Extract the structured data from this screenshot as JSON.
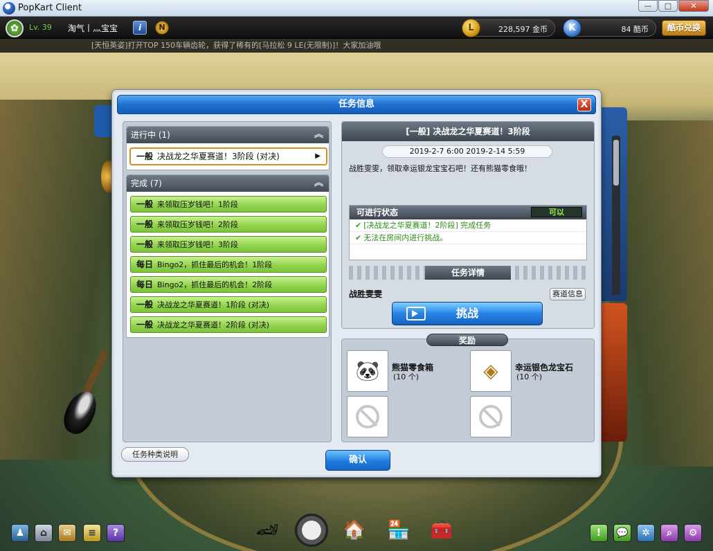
{
  "window": {
    "title": "PopKart Client",
    "min": "—",
    "max": "□",
    "close": "✕"
  },
  "player": {
    "level": "Lv. 39",
    "name": "淘气丨灬宝宝",
    "info_icon": "i",
    "badge": "N"
  },
  "currency": {
    "coin_icon": "L",
    "coins": "228,597 金币",
    "k_icon": "K",
    "kcoins": "84 酷币",
    "exchange": "酷币兑换"
  },
  "ticker": "[天恒英姿]打开TOP 150车辆齿轮，获得了稀有的[马拉松 9 LE(无限制)]！大家加油哦",
  "dialog": {
    "title": "任务信息",
    "close": "X",
    "in_progress": {
      "header": "进行中 (1)",
      "chevron": "︽",
      "items": [
        {
          "tag": "一般",
          "label": "决战龙之华夏赛道！3阶段 (对决)",
          "arrow": "▶"
        }
      ]
    },
    "completed": {
      "header": "完成 (7)",
      "chevron": "︽",
      "items": [
        {
          "tag": "一般",
          "label": "来领取压岁钱吧！1阶段"
        },
        {
          "tag": "一般",
          "label": "来领取压岁钱吧！2阶段"
        },
        {
          "tag": "一般",
          "label": "来领取压岁钱吧！3阶段"
        },
        {
          "tag": "每日",
          "label": "Bingo2，抓住最后的机会！1阶段"
        },
        {
          "tag": "每日",
          "label": "Bingo2，抓住最后的机会！2阶段"
        },
        {
          "tag": "一般",
          "label": "决战龙之华夏赛道！1阶段 (对决)"
        },
        {
          "tag": "一般",
          "label": "决战龙之华夏赛道！2阶段 (对决)"
        }
      ]
    },
    "type_help": "任务种类说明",
    "confirm": "确认",
    "detail": {
      "title": "[一般] 决战龙之华夏赛道！3阶段",
      "date": "2019-2-7 6:00  2019-2-14 5:59",
      "description": "战胜雯雯，领取幸运银龙宝宝石吧！还有熊猫零食哦！",
      "state_header": "可进行状态",
      "state_value": "可以",
      "conditions": [
        "[决战龙之华夏赛道！2阶段] 完成任务",
        "无法在房间内进行挑战。"
      ],
      "check": "✔",
      "section": "任务详情",
      "objective": "战胜雯雯",
      "track_info": "赛道信息",
      "challenge": "挑战"
    },
    "reward": {
      "header": "奖励",
      "items": [
        {
          "name": "熊猫零食箱",
          "qty": "(10 个)",
          "icon": "panda-snack-box-icon"
        },
        {
          "name": "幸运银色龙宝石",
          "qty": "(10 个)",
          "icon": "silver-dragon-gem-icon"
        }
      ]
    }
  },
  "toolbar": {
    "help": "?",
    "hint": "!",
    "icons": [
      "user-icon",
      "home-icon",
      "mailbox-icon",
      "notes-icon",
      "help-icon",
      "kart-garage-icon",
      "speedometer-icon",
      "garage-icon",
      "shop-icon",
      "toolbox-icon",
      "hint-icon",
      "chat-icon",
      "settings-icon",
      "search-icon",
      "options-icon"
    ]
  }
}
